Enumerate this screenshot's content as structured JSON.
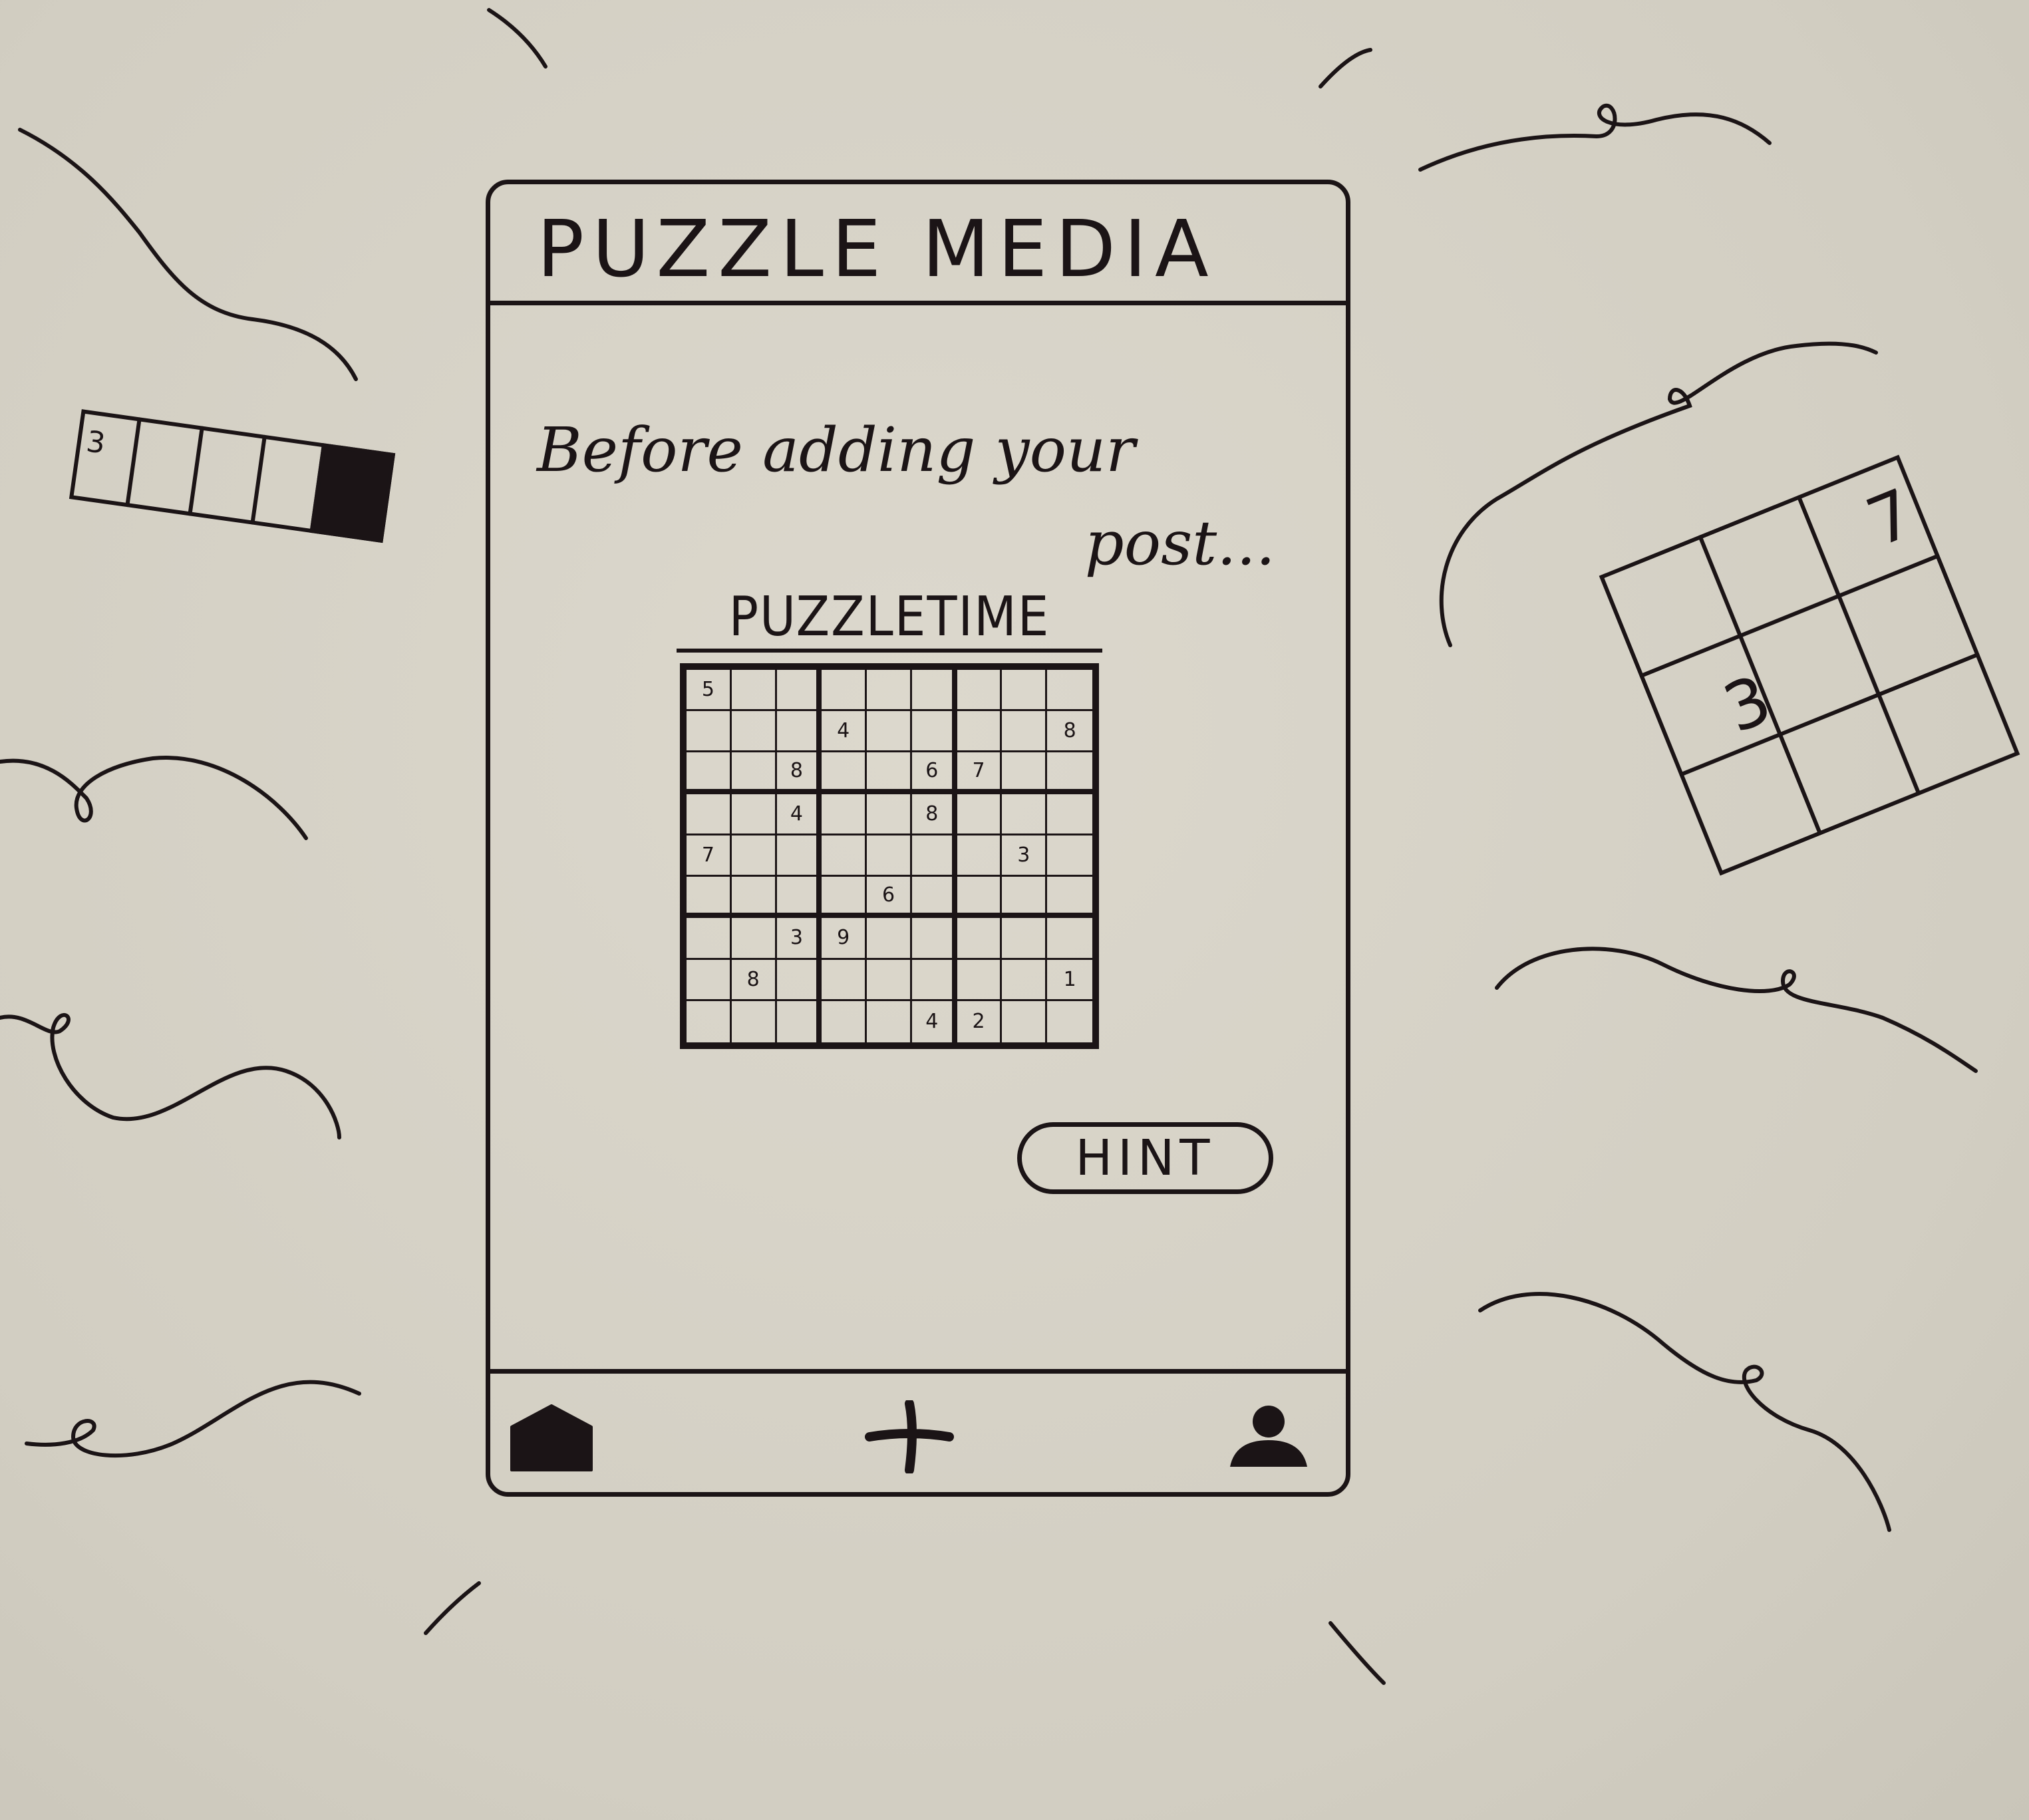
{
  "app": {
    "title": "PUZZLE MEDIA"
  },
  "intro": {
    "line1": "Before adding your",
    "line2": "post..."
  },
  "puzzle": {
    "title": "PUZZLETIME",
    "grid": [
      [
        "5",
        "",
        "",
        "",
        "",
        "",
        "",
        "",
        ""
      ],
      [
        "",
        "",
        "",
        "4",
        "",
        "",
        "",
        "",
        "8"
      ],
      [
        "",
        "",
        "8",
        "",
        "",
        "6",
        "7",
        "",
        ""
      ],
      [
        "",
        "",
        "4",
        "",
        "",
        "8",
        "",
        "",
        ""
      ],
      [
        "7",
        "",
        "",
        "",
        "",
        "",
        "",
        "3",
        ""
      ],
      [
        "",
        "",
        "",
        "",
        "6",
        "",
        "",
        "",
        ""
      ],
      [
        "",
        "",
        "3",
        "9",
        "",
        "",
        "",
        "",
        ""
      ],
      [
        "",
        "8",
        "",
        "",
        "",
        "",
        "",
        "",
        "1"
      ],
      [
        "",
        "",
        "",
        "",
        "",
        "4",
        "2",
        "",
        ""
      ]
    ]
  },
  "actions": {
    "hint_label": "HINT"
  },
  "nav": {
    "items": [
      {
        "name": "home",
        "icon": "home-icon"
      },
      {
        "name": "add",
        "icon": "plus-icon"
      },
      {
        "name": "profile",
        "icon": "user-icon"
      }
    ]
  },
  "decorations": {
    "left_strip_number": "3",
    "right_grid_numbers": [
      "7",
      "3"
    ]
  },
  "colors": {
    "ink": "#1b1416",
    "paper": "#d6d2c6"
  }
}
